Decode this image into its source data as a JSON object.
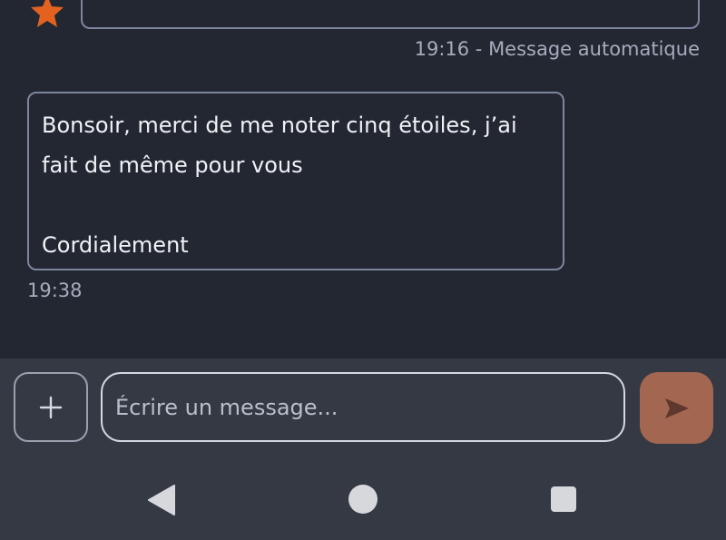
{
  "conversation": {
    "previous_message": {
      "time": "19:16",
      "separator": " - ",
      "label": "Message automatique"
    },
    "message": {
      "text": "Bonsoir, merci de me noter cinq étoiles, j’ai\nfait de même pour vous\n\nCordialement",
      "time": "19:38"
    }
  },
  "composer": {
    "placeholder": "Écrire un message..."
  },
  "icons": {
    "rating": "star-icon",
    "attach": "plus-icon",
    "send": "send-icon",
    "nav_back": "triangle-back-icon",
    "nav_home": "circle-home-icon",
    "nav_recents": "square-recents-icon"
  },
  "colors": {
    "background": "#222732",
    "panel": "#343943",
    "accent_star": "#e3621f",
    "send_button": "#a36650"
  }
}
